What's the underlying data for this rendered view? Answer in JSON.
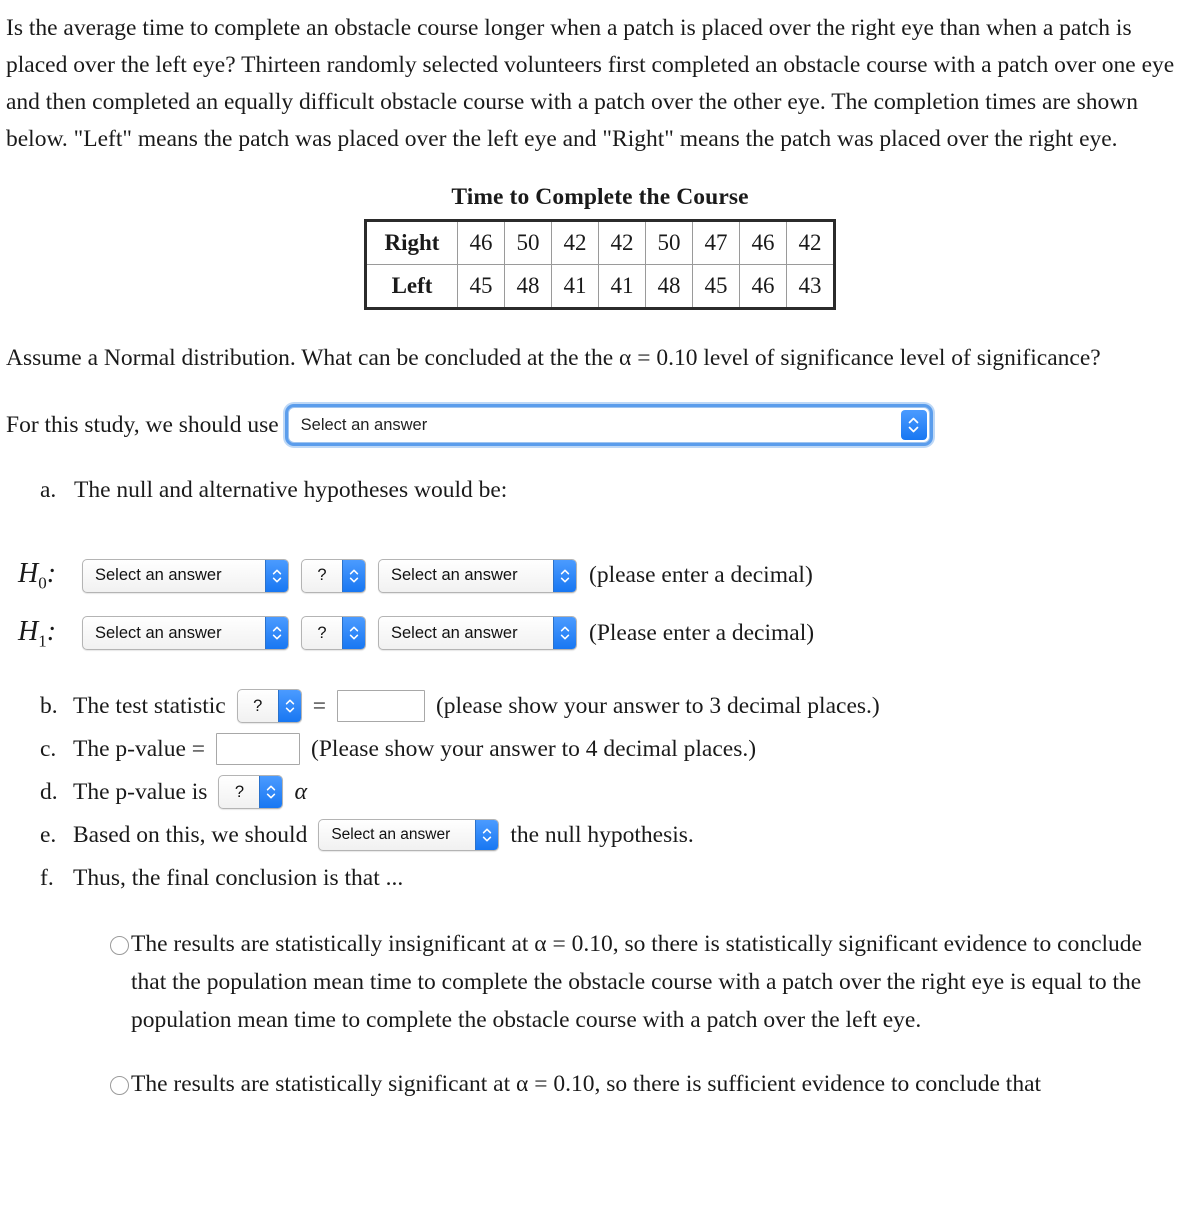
{
  "intro": {
    "paragraph": "Is the average time to complete an obstacle course longer when a patch is placed over the right eye than when a patch is placed over the left eye? Thirteen randomly selected volunteers first completed an obstacle course with a patch over one eye and then completed an equally difficult obstacle course with a patch over the other eye. The completion times are shown below. \"Left\" means the patch was placed over the left eye and \"Right\" means the patch was placed over the right eye."
  },
  "table": {
    "title": "Time to Complete the Course",
    "rows": [
      {
        "label": "Right",
        "values": [
          "46",
          "50",
          "42",
          "42",
          "50",
          "47",
          "46",
          "42"
        ]
      },
      {
        "label": "Left",
        "values": [
          "45",
          "48",
          "41",
          "41",
          "48",
          "45",
          "46",
          "43"
        ]
      }
    ]
  },
  "assume": {
    "text": "Assume a Normal distribution.  What can be concluded at the the α = 0.10 level of significance level of significance?"
  },
  "study": {
    "prompt": "For this study, we should use",
    "select_value": "Select an answer"
  },
  "item_a": {
    "marker": "a.",
    "text": "The null and alternative hypotheses would be:"
  },
  "hypotheses": {
    "h0": {
      "label": "H",
      "sub": "0",
      "colon": ":",
      "select1": "Select an answer",
      "select2": "?",
      "select3": "Select an answer",
      "note": "(please enter a decimal)"
    },
    "h1": {
      "label": "H",
      "sub": "1",
      "colon": ":",
      "select1": "Select an answer",
      "select2": "?",
      "select3": "Select an answer",
      "note": "(Please enter a decimal)"
    }
  },
  "steps": {
    "b": {
      "marker": "b.",
      "text": "The test statistic",
      "select": "?",
      "equals": "=",
      "input_value": "",
      "note": "(please show your answer to 3 decimal places.)"
    },
    "c": {
      "marker": "c.",
      "text": "The p-value =",
      "input_value": "",
      "note": "(Please show your answer to 4 decimal places.)"
    },
    "d": {
      "marker": "d.",
      "text": "The p-value is",
      "select": "?",
      "alpha": "α"
    },
    "e": {
      "marker": "e.",
      "text": "Based on this, we should",
      "select": "Select an answer",
      "text_after": "the null hypothesis."
    },
    "f": {
      "marker": "f.",
      "text": "Thus, the final conclusion is that ..."
    }
  },
  "choices": [
    {
      "text": "The results are statistically insignificant at α = 0.10, so there is statistically significant evidence to conclude that the population mean time to complete the obstacle course with a patch over the right eye is equal to the population mean time to complete the obstacle course with a patch over the left eye."
    },
    {
      "text": "The results are statistically significant at α = 0.10, so there is sufficient evidence to conclude that"
    }
  ],
  "colors": {
    "accent_blue": "#1877f2",
    "focus_ring": "#5b9dec",
    "table_border": "#2b2b2b"
  }
}
